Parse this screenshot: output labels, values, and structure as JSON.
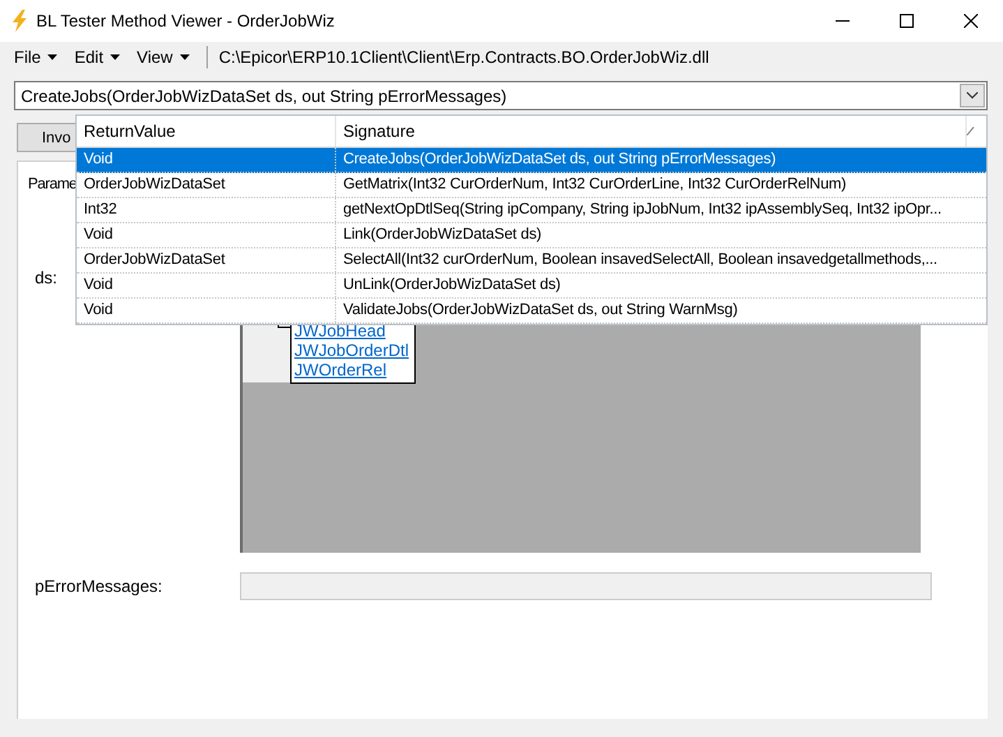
{
  "window": {
    "title": "BL Tester Method Viewer - OrderJobWiz"
  },
  "menu": [
    {
      "label": "File"
    },
    {
      "label": "Edit"
    },
    {
      "label": "View"
    }
  ],
  "assembly_path": "C:\\Epicor\\ERP10.1Client\\Client\\Erp.Contracts.BO.OrderJobWiz.dll",
  "method_select": {
    "value": "CreateJobs(OrderJobWizDataSet ds, out String pErrorMessages)"
  },
  "invoke_button": "Invo",
  "parameters_label": "Parame",
  "ds_label": "ds:",
  "dataset_tables": [
    "JWJobHead",
    "JWJobOrderDtl",
    "JWOrderRel"
  ],
  "error_messages_label": "pErrorMessages:",
  "dropdown": {
    "columns": [
      "ReturnValue",
      "Signature"
    ],
    "rows": [
      {
        "return_value": "Void",
        "signature": "CreateJobs(OrderJobWizDataSet ds, out String pErrorMessages)",
        "selected": true
      },
      {
        "return_value": "OrderJobWizDataSet",
        "signature": "GetMatrix(Int32 CurOrderNum, Int32 CurOrderLine, Int32 CurOrderRelNum)",
        "selected": false
      },
      {
        "return_value": "Int32",
        "signature": "getNextOpDtlSeq(String ipCompany, String ipJobNum, Int32 ipAssemblySeq, Int32 ipOpr...",
        "selected": false
      },
      {
        "return_value": "Void",
        "signature": "Link(OrderJobWizDataSet ds)",
        "selected": false
      },
      {
        "return_value": "OrderJobWizDataSet",
        "signature": "SelectAll(Int32 curOrderNum, Boolean insavedSelectAll, Boolean insavedgetallmethods,...",
        "selected": false
      },
      {
        "return_value": "Void",
        "signature": "UnLink(OrderJobWizDataSet ds)",
        "selected": false
      },
      {
        "return_value": "Void",
        "signature": "ValidateJobs(OrderJobWizDataSet ds, out String WarnMsg)",
        "selected": false
      }
    ]
  }
}
